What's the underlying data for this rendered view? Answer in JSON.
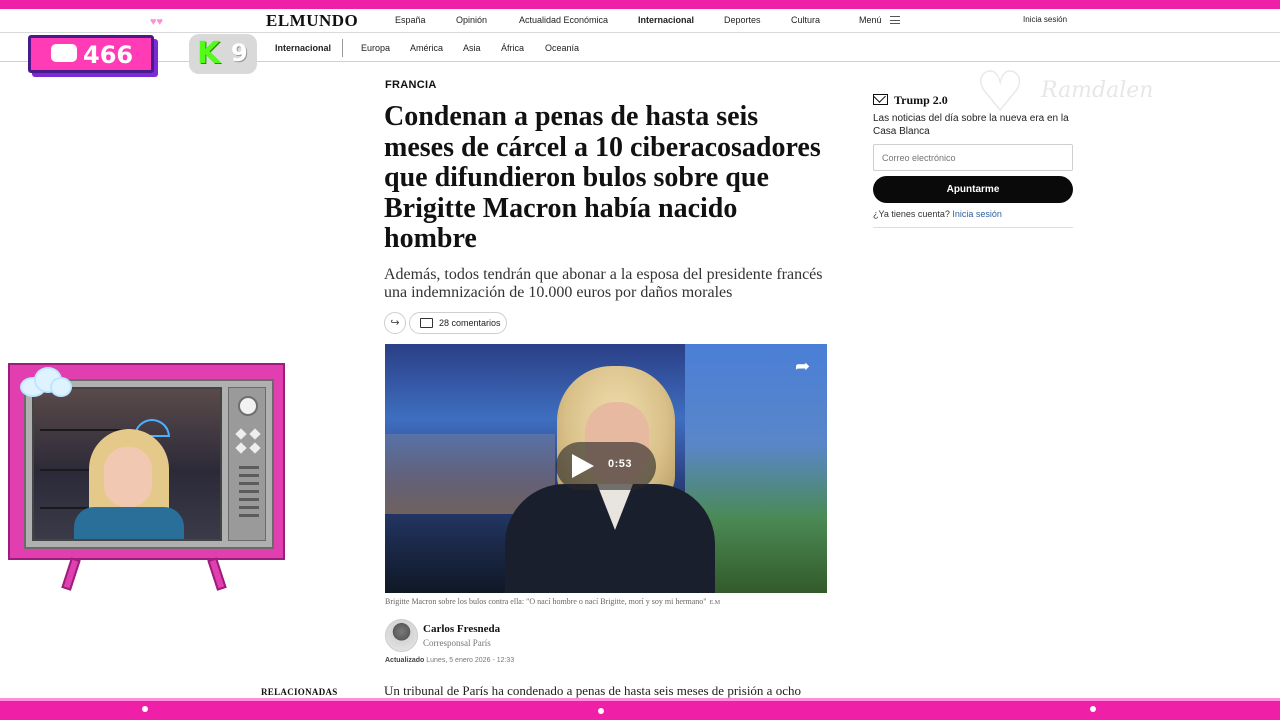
{
  "site": {
    "logo": "ELMUNDO",
    "top_nav": [
      "España",
      "Opinión",
      "Actualidad Económica",
      "Internacional",
      "Deportes",
      "Cultura",
      "Menú"
    ],
    "active_section": "Internacional",
    "login": "Inicia sesión"
  },
  "sub_nav": {
    "section": "Internacional",
    "items": [
      "Europa",
      "América",
      "Asia",
      "África",
      "Oceanía"
    ]
  },
  "overlay": {
    "chat_count": "466",
    "kick_letter": "K",
    "kick_count": "9",
    "hearts": "♥♥"
  },
  "article": {
    "kicker": "FRANCIA",
    "headline": "Condenan a penas de hasta seis meses de cárcel a 10 ciberacosadores que difundieron bulos sobre que Brigitte Macron había nacido hombre",
    "subtitle": "Además, todos tendrán que abonar a la esposa del presidente francés una indemnización de 10.000 euros por daños morales",
    "share_icon": "↪",
    "comments": "28 comentarios",
    "video": {
      "duration": "0:53",
      "share_icon": "➦"
    },
    "caption": "Brigitte Macron sobre los bulos contra ella: \"O nací hombre o nací Brigitte, morí y soy mi hermano\"",
    "caption_credit": "E.M",
    "author": {
      "name": "Carlos Fresneda",
      "role": "Corresponsal París"
    },
    "updated_label": "Actualizado",
    "updated_date": "Lunes, 5 enero 2026 - 12:33",
    "body_start": "Un tribunal de París ha condenado a penas de hasta seis meses de prisión a ocho",
    "related": "RELACIONADAS"
  },
  "newsletter": {
    "title": "Trump 2.0",
    "description": "Las noticias del día sobre la nueva era en la Casa Blanca",
    "email_placeholder": "Correo electrónico",
    "subscribe": "Apuntarme",
    "account_question": "¿Ya tienes cuenta?",
    "account_link": "Inicia sesión"
  },
  "watermark": {
    "heart": "♡",
    "text": "Ramdalen"
  },
  "colors": {
    "frame": "#f01fa8",
    "kick_green": "#53fc18",
    "link": "#2d5f9a"
  }
}
